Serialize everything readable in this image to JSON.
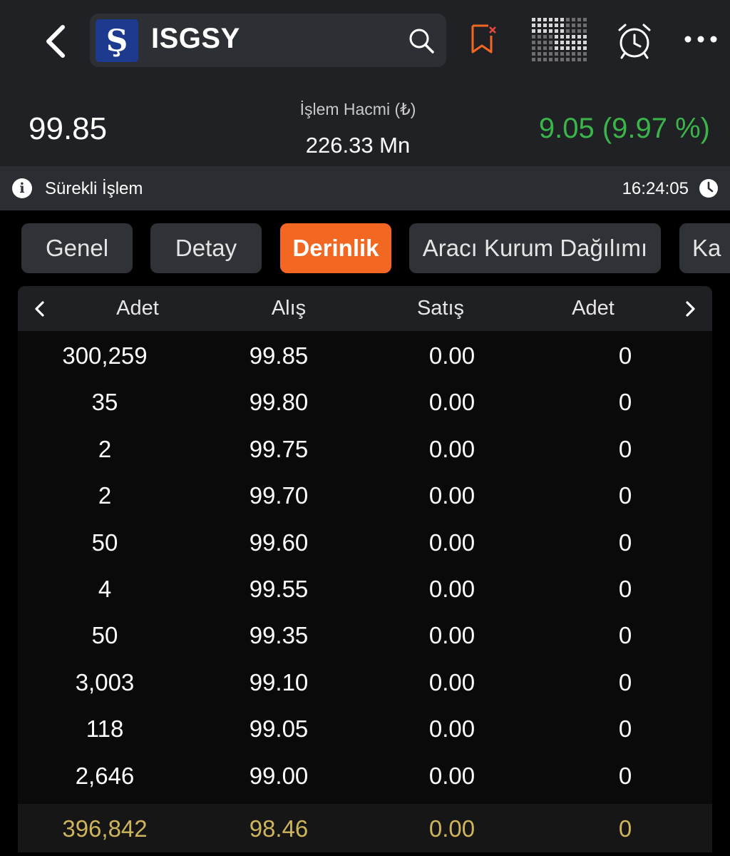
{
  "header": {
    "back_icon": "chevron-left-icon",
    "logo_letter": "Ş",
    "ticker": "ISGSY",
    "icons": [
      "search-icon",
      "bookmark-remove-icon",
      "heatmap-grid-icon",
      "alarm-clock-icon",
      "more-options-icon"
    ],
    "accent_color": "#f26722"
  },
  "quote": {
    "price": "99.85",
    "volume_label": "İşlem Hacmi (₺)",
    "volume_value": "226.33 Mn",
    "change": "9.05 (9.97 %)",
    "change_color": "#3bb54a"
  },
  "status": {
    "label": "Sürekli İşlem",
    "time": "16:24:05"
  },
  "tabs": [
    {
      "label": "Genel",
      "active": false
    },
    {
      "label": "Detay",
      "active": false
    },
    {
      "label": "Derinlik",
      "active": true
    },
    {
      "label": "Aracı Kurum Dağılımı",
      "active": false
    },
    {
      "label": "Ka",
      "active": false
    }
  ],
  "depth": {
    "headers": [
      "Adet",
      "Alış",
      "Satış",
      "Adet"
    ],
    "rows": [
      [
        "300,259",
        "99.85",
        "0.00",
        "0"
      ],
      [
        "35",
        "99.80",
        "0.00",
        "0"
      ],
      [
        "2",
        "99.75",
        "0.00",
        "0"
      ],
      [
        "2",
        "99.70",
        "0.00",
        "0"
      ],
      [
        "50",
        "99.60",
        "0.00",
        "0"
      ],
      [
        "4",
        "99.55",
        "0.00",
        "0"
      ],
      [
        "50",
        "99.35",
        "0.00",
        "0"
      ],
      [
        "3,003",
        "99.10",
        "0.00",
        "0"
      ],
      [
        "118",
        "99.05",
        "0.00",
        "0"
      ],
      [
        "2,646",
        "99.00",
        "0.00",
        "0"
      ]
    ],
    "total": [
      "396,842",
      "98.46",
      "0.00",
      "0"
    ],
    "total_color": "#cdb45d"
  }
}
